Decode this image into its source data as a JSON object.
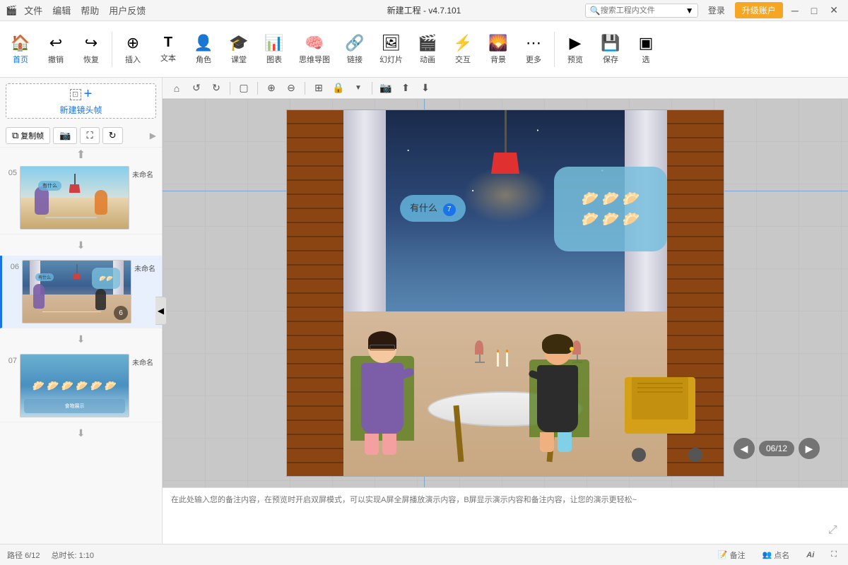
{
  "titlebar": {
    "menu_items": [
      "文件",
      "编辑",
      "帮助",
      "用户反馈"
    ],
    "title": "新建工程 - v4.7.101",
    "search_placeholder": "搜索工程内文件",
    "login_label": "登录",
    "upgrade_label": "升级账户",
    "win_min": "─",
    "win_max": "□",
    "win_close": "✕"
  },
  "toolbar": {
    "items": [
      {
        "id": "home",
        "icon": "🏠",
        "label": "首页"
      },
      {
        "id": "undo",
        "icon": "↩",
        "label": "撤销"
      },
      {
        "id": "redo",
        "icon": "↪",
        "label": "恢复"
      },
      {
        "id": "insert",
        "icon": "➕",
        "label": "插入"
      },
      {
        "id": "text",
        "icon": "T",
        "label": "文本"
      },
      {
        "id": "character",
        "icon": "👤",
        "label": "角色"
      },
      {
        "id": "class",
        "icon": "🎓",
        "label": "课堂"
      },
      {
        "id": "chart",
        "icon": "📊",
        "label": "图表"
      },
      {
        "id": "mindmap",
        "icon": "🧠",
        "label": "思维导图"
      },
      {
        "id": "link",
        "icon": "🔗",
        "label": "链接"
      },
      {
        "id": "slides",
        "icon": "🖼",
        "label": "幻灯片"
      },
      {
        "id": "animation",
        "icon": "🎬",
        "label": "动画"
      },
      {
        "id": "interact",
        "icon": "⚡",
        "label": "交互"
      },
      {
        "id": "background",
        "icon": "🖼",
        "label": "背景"
      },
      {
        "id": "more",
        "icon": "⋯",
        "label": "更多"
      },
      {
        "id": "preview",
        "icon": "▶",
        "label": "预览"
      },
      {
        "id": "save",
        "icon": "💾",
        "label": "保存"
      },
      {
        "id": "select",
        "icon": "▣",
        "label": "选"
      }
    ]
  },
  "sidebar": {
    "new_frame_label": "新建镜头帧",
    "copy_frame_label": "复制帧",
    "slides": [
      {
        "num": "05",
        "name": "未命名",
        "active": false,
        "theme": "warm"
      },
      {
        "num": "06",
        "name": "未命名",
        "active": true,
        "badge": "6",
        "theme": "restaurant"
      },
      {
        "num": "07",
        "name": "未命名",
        "active": false,
        "theme": "food"
      }
    ]
  },
  "canvas": {
    "tools": [
      "⌂",
      "↩",
      "↺",
      "⬜",
      "⊕",
      "⊖",
      "◈",
      "⊟",
      "📸",
      "↗",
      "↙"
    ],
    "guide_lines": true
  },
  "slide_content": {
    "speech_left": "有什么",
    "page_num": "06/12"
  },
  "notes": {
    "placeholder": "在此处输入您的备注内容，在预览时开启双屏模式，可以实现A屏全屏播放演示内容，B屏显示演示内容和备注内容，让您的演示更轻松~"
  },
  "statusbar": {
    "path_label": "路径",
    "path_value": "6/12",
    "duration_label": "总时长:",
    "duration_value": "1:10",
    "annotation_label": "备注",
    "points_label": "点名",
    "ai_label": "Ai"
  },
  "canvas_toolbar_icons": {
    "home": "⌂",
    "undo": "↺",
    "redo": "↻",
    "rect": "▢",
    "zoom_in": "⊕",
    "zoom_out": "⊖",
    "grid": "⊞",
    "lock": "🔒",
    "photo": "📷",
    "export": "⬆",
    "more": "…"
  }
}
